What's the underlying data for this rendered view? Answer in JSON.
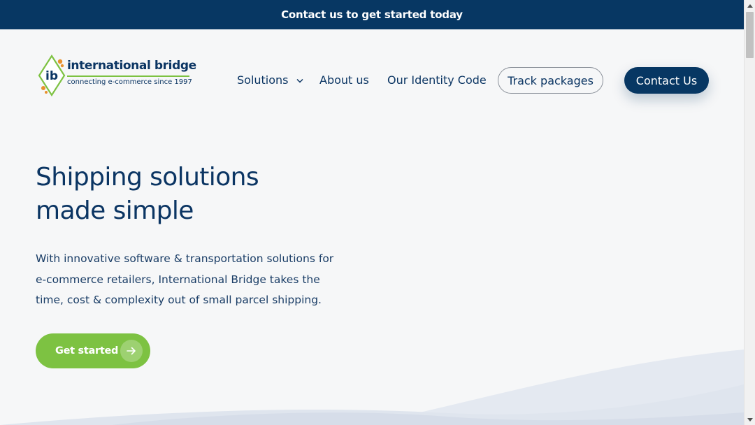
{
  "announcement": {
    "text": "Contact us to get started today"
  },
  "logo": {
    "initials": "ib",
    "name": "international bridge",
    "tagline": "connecting e-commerce since 1997"
  },
  "nav": {
    "items": [
      {
        "label": "Solutions",
        "has_dropdown": true
      },
      {
        "label": "About us"
      },
      {
        "label": "Our Identity Code"
      }
    ],
    "track_label": "Track packages",
    "contact_label": "Contact Us"
  },
  "hero": {
    "title_line1": "Shipping solutions",
    "title_line2": "made simple",
    "description": "With innovative software & transportation solutions for e-commerce retailers, International Bridge takes the time, cost & complexity out of small parcel shipping.",
    "cta_label": "Get started"
  },
  "colors": {
    "brand_navy": "#073763",
    "accent_green": "#7dc242",
    "accent_orange": "#e8912d",
    "background": "#f6f7f8"
  }
}
